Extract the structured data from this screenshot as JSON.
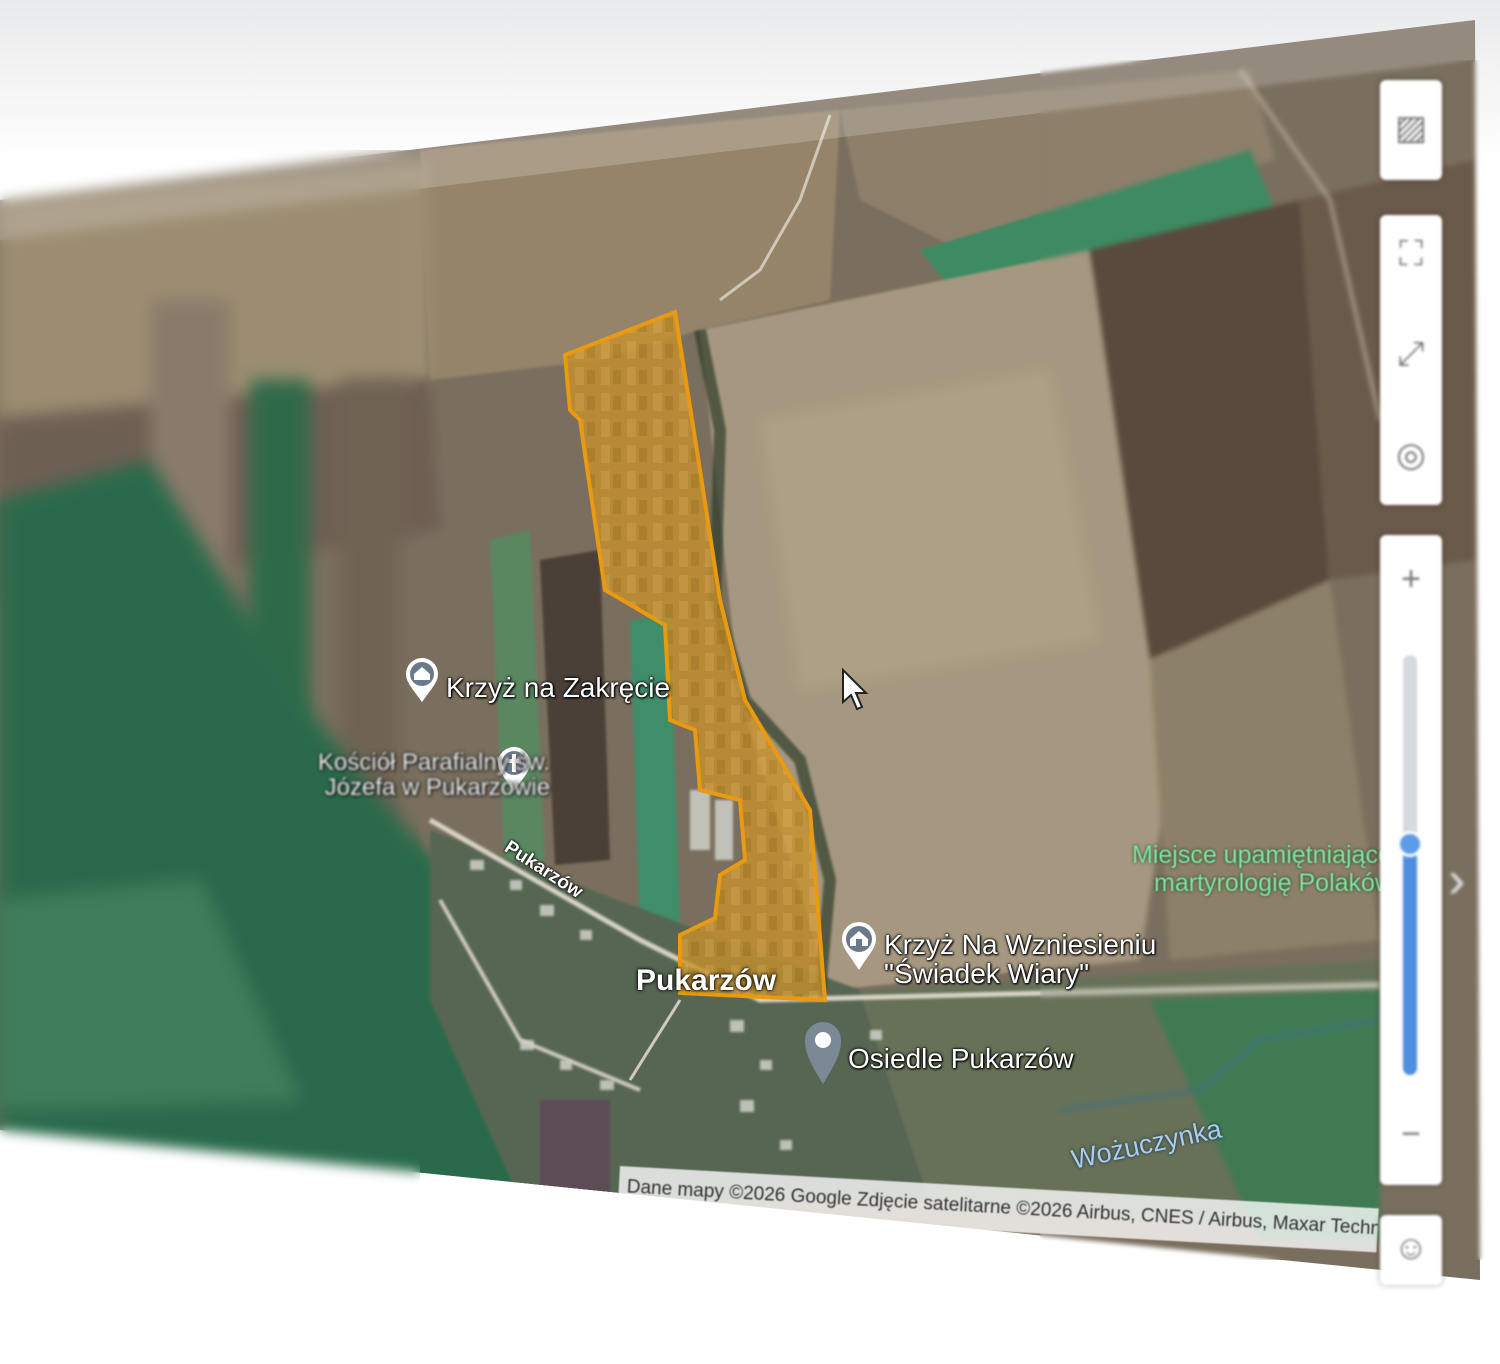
{
  "map": {
    "type": "satellite",
    "highlight_color": "#e8a521",
    "water_label_color": "#a9cdf2",
    "park_label_color": "#7fe7a2"
  },
  "labels": {
    "town": "Pukarzów",
    "road": "Pukarzów",
    "river": "Wożuczynka",
    "memorial_line1": "Miejsce upamiętniające",
    "memorial_line2": "martyrologię Polaków",
    "church_line1": "Kościół Parafialny św.",
    "church_line2": "Józefa w Pukarzowie"
  },
  "pois": [
    {
      "name": "Krzyż na Zakręcie",
      "icon": "shrine-icon"
    },
    {
      "name_line1": "Krzyż Na Wzniesieniu",
      "name_line2": "\"Świadek Wiary\"",
      "icon": "shrine-icon"
    },
    {
      "name": "Osiedle Pukarzów",
      "icon": "location-pin-icon"
    }
  ],
  "attribution": "Dane mapy ©2026 Google Zdjęcie satelitarne ©2026 Airbus, CNES / Airbus, Maxar Technologies",
  "controls": {
    "layers": "layers-icon",
    "fullscreen": "fullscreen-icon",
    "measure": "measure-icon",
    "locate": "locate-icon",
    "zoom_in": "+",
    "zoom_out": "−",
    "zoom_level": 0.55,
    "street_view": "pegman-icon"
  }
}
